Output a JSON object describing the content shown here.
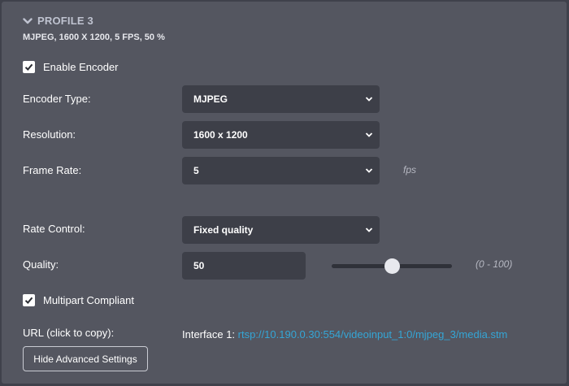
{
  "profile": {
    "title": "PROFILE 3",
    "summary": "MJPEG, 1600 X 1200, 5 FPS, 50 %"
  },
  "enable_encoder": {
    "label": "Enable Encoder",
    "checked": true
  },
  "encoder_type": {
    "label": "Encoder Type:",
    "value": "MJPEG"
  },
  "resolution": {
    "label": "Resolution:",
    "value": "1600 x 1200"
  },
  "frame_rate": {
    "label": "Frame Rate:",
    "value": "5",
    "unit": "fps"
  },
  "rate_control": {
    "label": "Rate Control:",
    "value": "Fixed quality"
  },
  "quality": {
    "label": "Quality:",
    "value": "50",
    "range": "(0 - 100)",
    "slider_fraction": 0.5
  },
  "multipart": {
    "label": "Multipart Compliant",
    "checked": true
  },
  "url": {
    "label": "URL (click to copy):",
    "interface_label": "Interface 1:",
    "link": "rtsp://10.190.0.30:554/videoinput_1:0/mjpeg_3/media.stm"
  },
  "advanced_button": {
    "label": "Hide Advanced Settings"
  },
  "colors": {
    "panel": "#545660",
    "field": "#3d3f48",
    "link": "#34a6d6",
    "title": "#bfc3d0"
  }
}
